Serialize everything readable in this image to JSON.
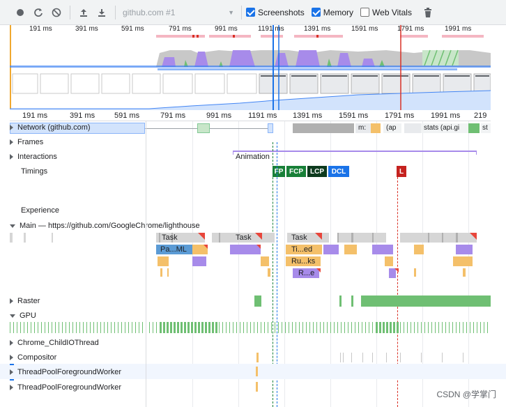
{
  "toolbar": {
    "profile": "github.com #1",
    "screenshots_label": "Screenshots",
    "memory_label": "Memory",
    "web_vitals_label": "Web Vitals",
    "screenshots_checked": true,
    "memory_checked": true,
    "web_vitals_checked": false
  },
  "overview_ticks": [
    "191 ms",
    "391 ms",
    "591 ms",
    "791 ms",
    "991 ms",
    "1191 ms",
    "1391 ms",
    "1591 ms",
    "1791 ms",
    "1991 ms"
  ],
  "ruler_ticks": [
    "191 ms",
    "391 ms",
    "591 ms",
    "791 ms",
    "991 ms",
    "1191 ms",
    "1391 ms",
    "1591 ms",
    "1791 ms",
    "1991 ms",
    "219"
  ],
  "tracks": {
    "network": "Network",
    "network_host": "(github.com)",
    "frames": "Frames",
    "interactions": "Interactions",
    "animation": "Animation",
    "timings": "Timings",
    "experience": "Experience",
    "main": "Main — https://github.com/GoogleChrome/lighthouse",
    "raster": "Raster",
    "gpu": "GPU",
    "child_io": "Chrome_ChildIOThread",
    "compositor": "Compositor",
    "pool1": "ThreadPoolForegroundWorker",
    "pool2": "ThreadPoolForegroundWorker"
  },
  "network_labels": [
    "m:",
    "(ap",
    "stats (api.gi",
    "st"
  ],
  "timings_markers": [
    {
      "label": "FP",
      "color": "#188038"
    },
    {
      "label": "FCP",
      "color": "#188038"
    },
    {
      "label": "LCP",
      "color": "#0d3b1e"
    },
    {
      "label": "DCL",
      "color": "#1a73e8"
    },
    {
      "label": "L",
      "color": "#c5221f"
    }
  ],
  "main_tasks": {
    "task1": "Task",
    "task2": "Task",
    "task3": "Task",
    "pa": "Pa...ML",
    "ti": "Ti...ed",
    "ru": "Ru...ks",
    "re": "R...e"
  },
  "watermark": "CSDN @学掌门",
  "colors": {
    "scripting": "#f4c06a",
    "rendering": "#a78bea",
    "painting": "#6fbf73",
    "loading": "#5b9bd5",
    "task": "#d6d6d6",
    "longtask": "#e8463b"
  }
}
